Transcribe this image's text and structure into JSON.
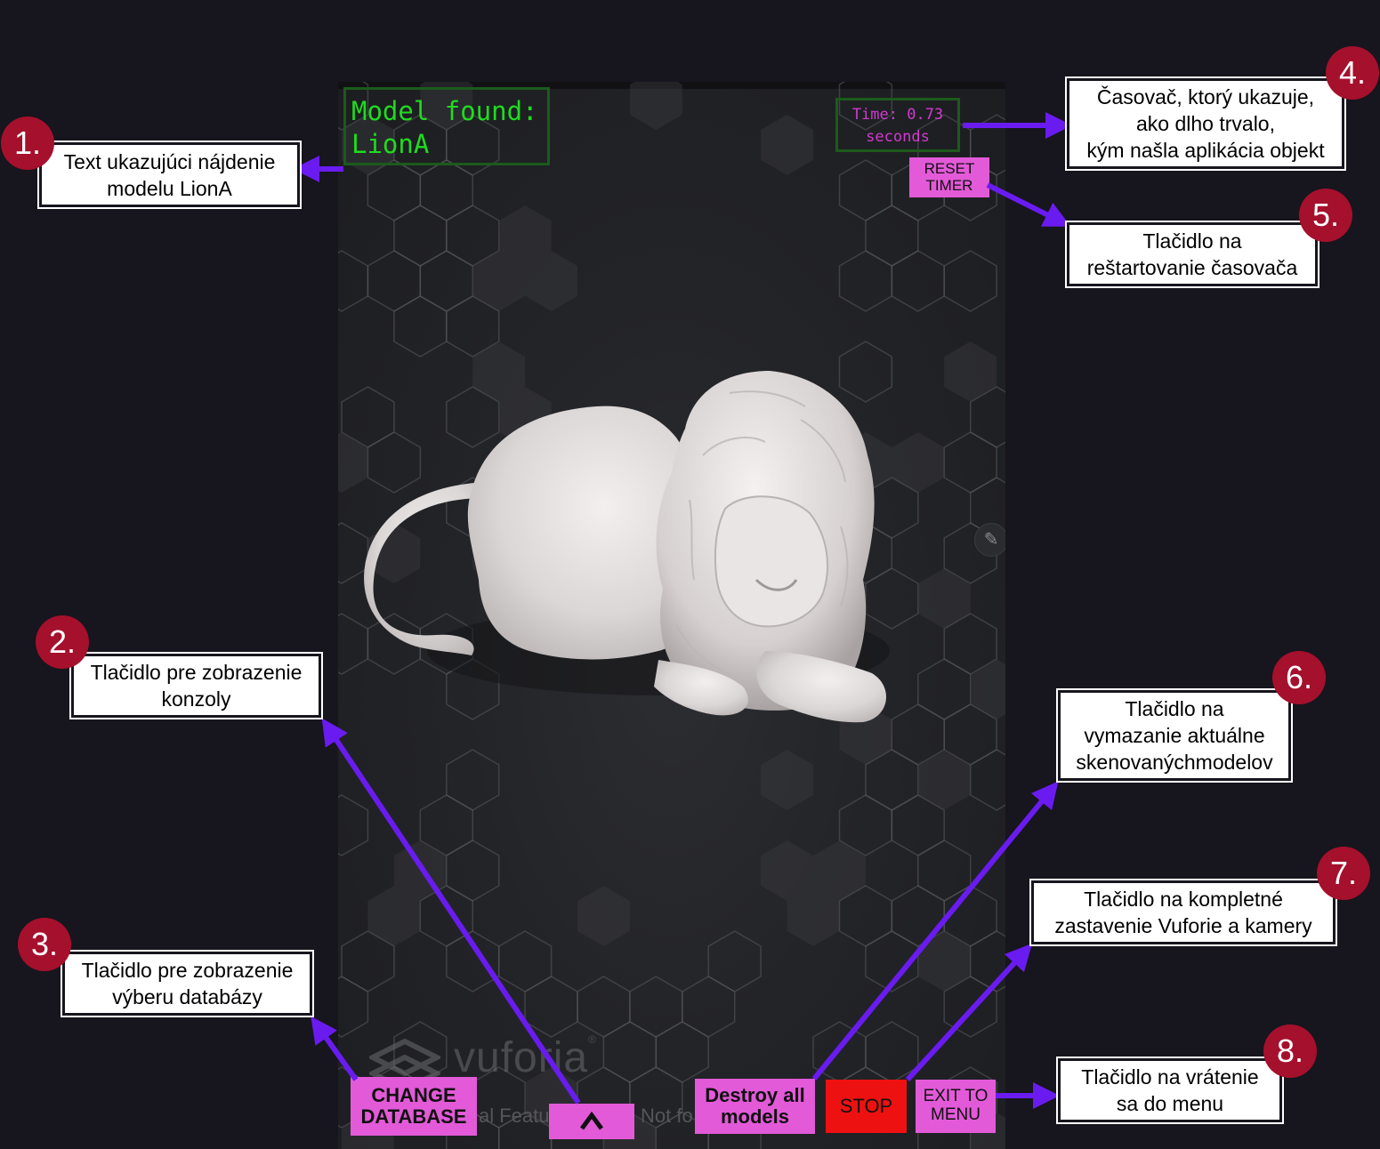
{
  "app": {
    "status_text": "Model found:\nLionA",
    "timer_text": "Time: 0.73\nseconds",
    "reset_timer_label": "RESET\nTIMER",
    "change_database_label": "CHANGE\nDATABASE",
    "console_toggle_label": "^",
    "destroy_all_label": "Destroy all\nmodels",
    "stop_label": "STOP",
    "exit_menu_label": "EXIT TO\nMENU",
    "watermark_brand": "vuforia",
    "watermark_trademark": "®",
    "watermark_note_left": "al Featu",
    "watermark_note_right": "Not fo"
  },
  "annotations": [
    {
      "number": "1.",
      "text": "Text ukazujúci nájdenie\nmodelu LionA"
    },
    {
      "number": "2.",
      "text": "Tlačidlo pre zobrazenie\nkonzoly"
    },
    {
      "number": "3.",
      "text": "Tlačidlo pre zobrazenie\nvýberu databázy"
    },
    {
      "number": "4.",
      "text": "Časovač, ktorý ukazuje,\nako dlho trvalo,\nkým našla aplikácia objekt"
    },
    {
      "number": "5.",
      "text": "Tlačidlo na\nreštartovanie časovača"
    },
    {
      "number": "6.",
      "text": "Tlačidlo na\nvymazanie aktuálne\nskenovanýchmodelov"
    },
    {
      "number": "7.",
      "text": "Tlačidlo na kompletné\nzastavenie Vuforie a kamery"
    },
    {
      "number": "8.",
      "text": "Tlačidlo na vrátenie\nsa do menu"
    }
  ],
  "colors": {
    "background": "#17151d",
    "button_pink": "#e25ad8",
    "stop_red": "#ee1111",
    "status_green": "#1fdc1f",
    "timer_magenta": "#d13ad1",
    "arrow_purple": "#6a1bf0",
    "badge_red": "#a5102d"
  }
}
